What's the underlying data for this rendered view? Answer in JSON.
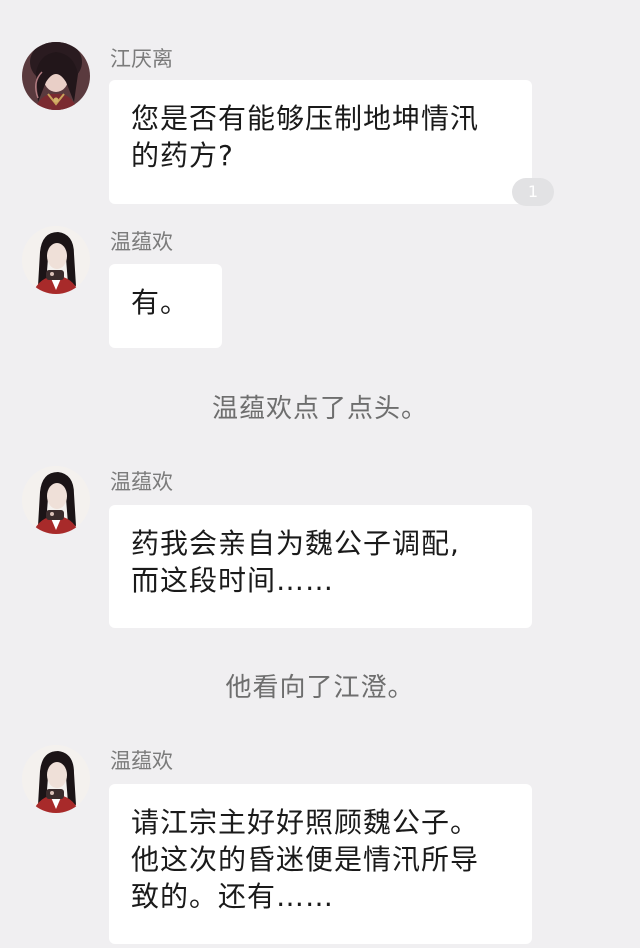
{
  "messages": [
    {
      "sender": "江厌离",
      "text": "您是否有能够压制地坤情汛\n的药方?",
      "badge": "1",
      "avatar": "jiang-yanli-avatar"
    },
    {
      "sender": "温蕴欢",
      "text": "有。",
      "avatar": "wen-yunhuan-avatar"
    },
    {
      "sender": "温蕴欢",
      "text": "药我会亲自为魏公子调配,\n而这段时间……",
      "avatar": "wen-yunhuan-avatar"
    },
    {
      "sender": "温蕴欢",
      "text": "请江宗主好好照顾魏公子。\n他这次的昏迷便是情汛所导\n致的。还有……",
      "avatar": "wen-yunhuan-avatar"
    }
  ],
  "narrations": [
    "温蕴欢点了点头。",
    "他看向了江澄。"
  ],
  "colors": {
    "background": "#f0eff1",
    "bubble": "#ffffff",
    "sender_text": "#7b7b7b",
    "narration_text": "#6e6e6e",
    "badge": "#e2e2e4"
  }
}
